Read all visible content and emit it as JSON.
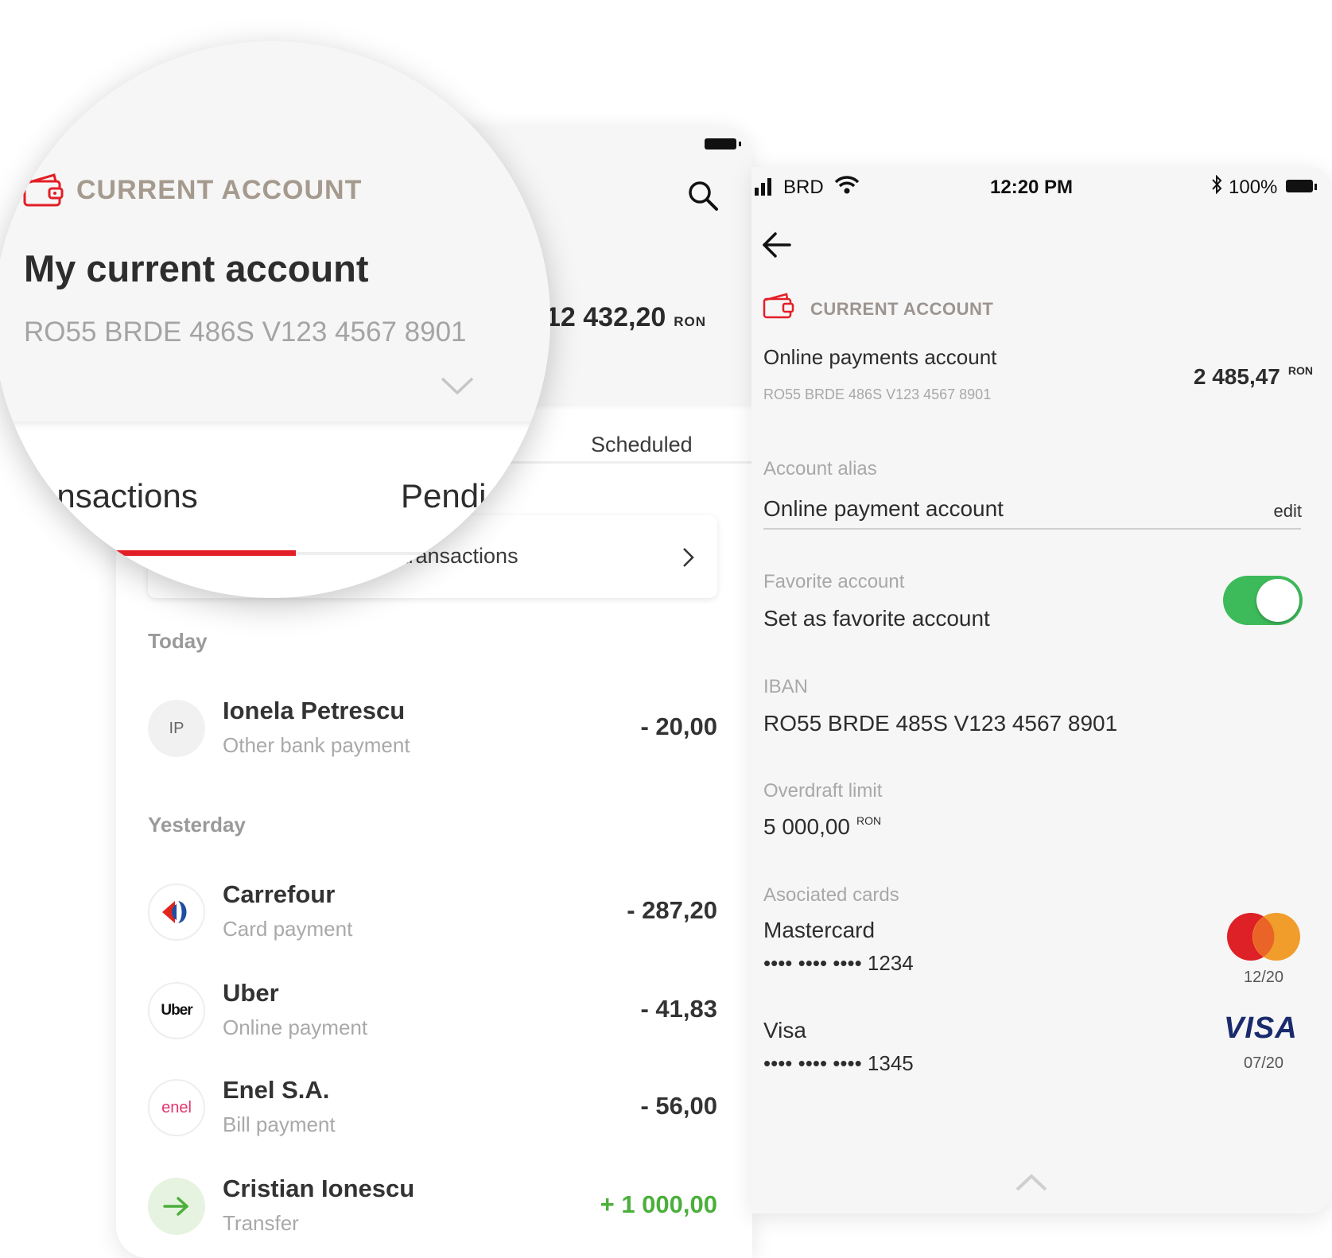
{
  "left_screen": {
    "balance": "12 432,20",
    "balance_currency": "RON",
    "tabs": [
      "Transactions",
      "Pending",
      "Scheduled"
    ],
    "all_transactions_label": "transactions",
    "groups": [
      {
        "day": "Today",
        "items": [
          {
            "initials": "IP",
            "name": "Ionela Petrescu",
            "type": "Other bank payment",
            "amount": "- 20,00"
          }
        ]
      },
      {
        "day": "Yesterday",
        "items": [
          {
            "logo": "carrefour-logo",
            "name": "Carrefour",
            "type": "Card payment",
            "amount": "- 287,20"
          },
          {
            "logo_text": "Uber",
            "name": "Uber",
            "type": "Online payment",
            "amount": "- 41,83"
          },
          {
            "logo_text": "enel",
            "name": "Enel S.A.",
            "type": "Bill payment",
            "amount": "- 56,00"
          },
          {
            "logo": "arrow-right-icon",
            "name": "Cristian Ionescu",
            "type": "Transfer",
            "amount": "+ 1 000,00"
          }
        ]
      }
    ]
  },
  "magnifier": {
    "account_type": "CURRENT ACCOUNT",
    "account_name": "My current account",
    "iban": "RO55 BRDE 486S V123 4567 8901",
    "tab_active": "ransactions",
    "tab_next": "Pendi"
  },
  "right_screen": {
    "status_bar": {
      "carrier": "BRD",
      "time": "12:20 PM",
      "battery": "100%"
    },
    "account_type": "CURRENT ACCOUNT",
    "account_name": "Online payments account",
    "iban_small": "RO55 BRDE 486S V123 4567 8901",
    "balance": "2 485,47",
    "balance_currency": "RON",
    "alias_label": "Account alias",
    "alias_value": "Online payment account",
    "edit_label": "edit",
    "favorite_label": "Favorite account",
    "favorite_value": "Set as favorite account",
    "favorite_on": true,
    "iban_label": "IBAN",
    "iban_value": "RO55 BRDE 485S V123 4567 8901",
    "overdraft_label": "Overdraft limit",
    "overdraft_value": "5 000,00",
    "overdraft_currency": "RON",
    "cards_label": "Asociated cards",
    "cards": [
      {
        "name": "Mastercard",
        "number": "•••• •••• •••• 1234",
        "expiry": "12/20"
      },
      {
        "name": "Visa",
        "number": "•••• •••• •••• 1345",
        "expiry": "07/20",
        "brand_text": "VISA"
      }
    ]
  },
  "colors": {
    "accent_red": "#e41e26",
    "toggle_green": "#3dbb5b",
    "positive_green": "#4caf3c",
    "visa_blue": "#1a2b6d"
  }
}
